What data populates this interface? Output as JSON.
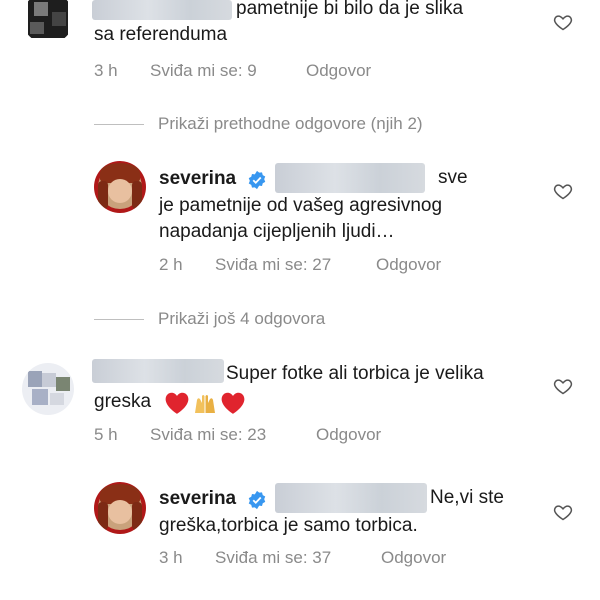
{
  "comment1": {
    "text_line1": "pametnije bi bilo da je slika",
    "text_line2": "sa referenduma",
    "time": "3 h",
    "likes": "Sviđa mi se: 9",
    "reply": "Odgovor"
  },
  "divider1": {
    "label": "Prikaži prethodne odgovore (njih 2)"
  },
  "reply1": {
    "username": "severina",
    "verified_icon": "verified-badge-icon",
    "text_line1_end": "sve",
    "text_line2": "je pametnije od vašeg agresivnog",
    "text_line3": "napadanja cijepljenih ljudi…",
    "time": "2 h",
    "likes": "Sviđa mi se: 27",
    "reply": "Odgovor"
  },
  "divider2": {
    "label": "Prikaži još 4 odgovora"
  },
  "comment2": {
    "text_line1": "Super fotke ali torbica je velika",
    "text_line2": "greska",
    "emojis": [
      "red-heart",
      "raising-hands",
      "red-heart"
    ],
    "time": "5 h",
    "likes": "Sviđa mi se: 23",
    "reply": "Odgovor"
  },
  "reply2": {
    "username": "severina",
    "verified_icon": "verified-badge-icon",
    "text_line1_end": "Ne,vi ste",
    "text_line2": "greška,torbica je samo torbica.",
    "time": "3 h",
    "likes": "Sviđa mi se: 37",
    "reply": "Odgovor"
  },
  "colors": {
    "text": "#1a1a1a",
    "meta": "#8a8a8a",
    "verified": "#3897f0",
    "heart_red": "#e0242e"
  }
}
